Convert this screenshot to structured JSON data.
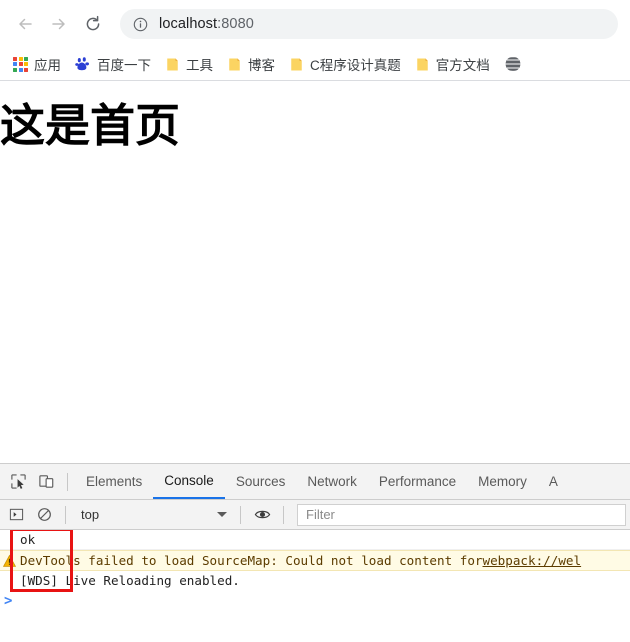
{
  "browser": {
    "nav": {
      "back_label": "Back",
      "forward_label": "Forward",
      "reload_label": "Reload"
    },
    "omnibox": {
      "security_icon": "info-circle-icon",
      "host": "localhost",
      "port": ":8080",
      "full_url": "localhost:8080"
    },
    "bookmarks": [
      {
        "label": "应用",
        "icon": "apps-grid-icon"
      },
      {
        "label": "百度一下",
        "icon": "baidu-paw-icon"
      },
      {
        "label": "工具",
        "icon": "folder-icon"
      },
      {
        "label": "博客",
        "icon": "folder-icon"
      },
      {
        "label": "C程序设计真题",
        "icon": "folder-icon"
      },
      {
        "label": "官方文档",
        "icon": "folder-icon"
      },
      {
        "label": "",
        "icon": "globe-icon"
      }
    ]
  },
  "page": {
    "heading": "这是首页"
  },
  "devtools": {
    "toolbar_icons": {
      "inspect": "inspect-element-icon",
      "device": "device-toolbar-icon"
    },
    "tabs": [
      {
        "label": "Elements",
        "active": false
      },
      {
        "label": "Console",
        "active": true
      },
      {
        "label": "Sources",
        "active": false
      },
      {
        "label": "Network",
        "active": false
      },
      {
        "label": "Performance",
        "active": false
      },
      {
        "label": "Memory",
        "active": false
      },
      {
        "label": "A",
        "active": false
      }
    ],
    "console_toolbar": {
      "sidebar_icon": "console-sidebar-icon",
      "clear_icon": "clear-console-icon",
      "context": "top",
      "eye_icon": "live-expression-eye-icon",
      "filter_placeholder": "Filter"
    },
    "console_messages": [
      {
        "level": "log",
        "text": "ok"
      },
      {
        "level": "warning",
        "icon": "warning-triangle-icon",
        "text": "DevTools failed to load SourceMap: Could not load content for ",
        "link": "webpack://wel"
      },
      {
        "level": "info",
        "text": "[WDS] Live Reloading enabled."
      }
    ],
    "prompt_symbol": ">"
  },
  "annotation": {
    "color": "#e81313"
  }
}
